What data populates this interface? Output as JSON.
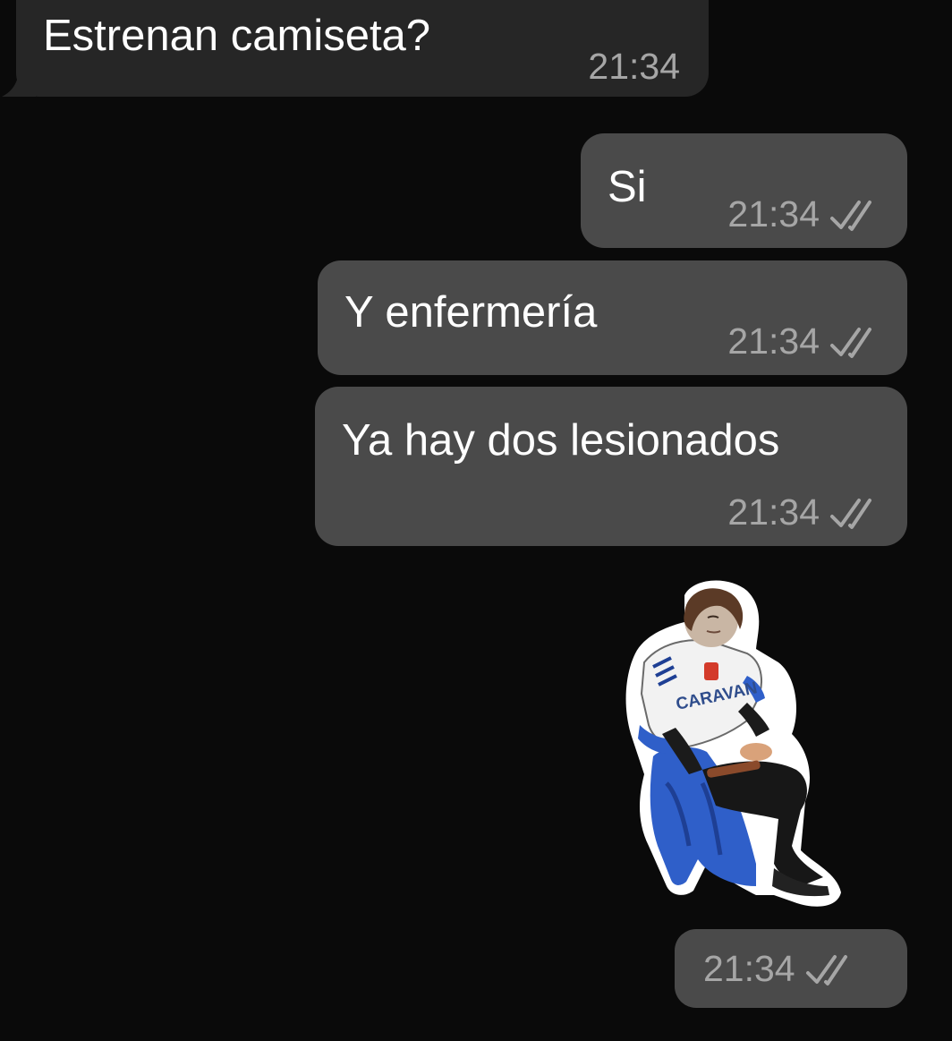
{
  "messages": [
    {
      "direction": "incoming",
      "text": "Estrenan camiseta?",
      "time": "21:34"
    },
    {
      "direction": "outgoing",
      "text": "Si",
      "time": "21:34",
      "status": "read"
    },
    {
      "direction": "outgoing",
      "text": "Y enfermería",
      "time": "21:34",
      "status": "read"
    },
    {
      "direction": "outgoing",
      "text": "Ya hay dos lesionados",
      "time": "21:34",
      "status": "read"
    },
    {
      "direction": "outgoing",
      "type": "sticker",
      "sticker_jersey_text": "CARAVAN",
      "time": "21:34",
      "status": "read"
    }
  ],
  "icons": {
    "read_receipt": "double-check-icon",
    "bubble_tail": "bubble-tail-icon"
  },
  "colors": {
    "background": "#0a0a0a",
    "incoming_bubble": "#262626",
    "outgoing_bubble": "#4a4a4a",
    "text": "#ffffff",
    "meta_text": "#a6a6a6"
  }
}
